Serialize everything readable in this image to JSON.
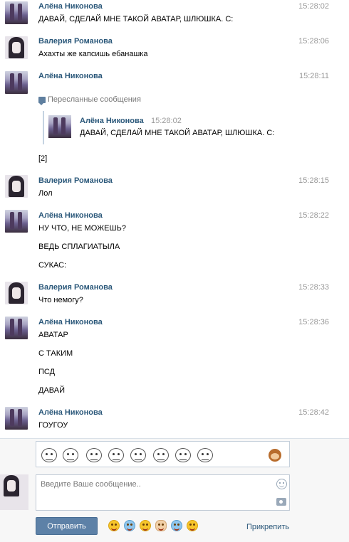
{
  "messages": [
    {
      "author": "Алёна Никонова",
      "time": "15:28:02",
      "lines": [
        "ДАВАЙ, СДЕЛАЙ МНЕ ТАКОЙ АВАТАР, ШЛЮШКА. С:"
      ]
    },
    {
      "author": "Валерия Романова",
      "time": "15:28:06",
      "lines": [
        "Ахахты же капсишь ебанашка"
      ]
    },
    {
      "author": "Алёна Никонова",
      "time": "15:28:11",
      "lines": [
        "[2]"
      ]
    },
    {
      "author": "Валерия Романова",
      "time": "15:28:15",
      "lines": [
        "Лол"
      ]
    },
    {
      "author": "Алёна Никонова",
      "time": "15:28:22",
      "lines": [
        "НУ ЧТО, НЕ МОЖЕШЬ?",
        "ВЕДЬ СПЛАГИАТЫЛА",
        "СУКАС:"
      ]
    },
    {
      "author": "Валерия Романова",
      "time": "15:28:33",
      "lines": [
        "Что немогу?"
      ]
    },
    {
      "author": "Алёна Никонова",
      "time": "15:28:36",
      "lines": [
        "АВАТАР",
        "С ТАКИМ",
        "ПСД",
        "ДАВАЙ"
      ]
    },
    {
      "author": "Алёна Никонова",
      "time": "15:28:42",
      "lines": [
        "ГОУГОУ"
      ]
    }
  ],
  "forwarded": {
    "label": "Пересланные сообщения",
    "author": "Алёна Никонова",
    "time": "15:28:02",
    "text": "ДАВАЙ, СДЕЛАЙ МНЕ ТАКОЙ АВАТАР, ШЛЮШКА. С:"
  },
  "composer": {
    "placeholder": "Введите Ваше сообщение..",
    "send_label": "Отправить",
    "attach_label": "Прикрепить"
  },
  "icons": {
    "stickers": [
      "meme-face-icon",
      "meme-face-icon",
      "meme-face-icon",
      "meme-face-icon",
      "meme-face-icon",
      "meme-face-icon",
      "meme-face-icon",
      "meme-face-icon"
    ],
    "emoji": [
      "smile-emoji-icon",
      "crying-emoji-icon",
      "laughing-emoji-icon",
      "ok-hand-emoji-icon",
      "tears-of-joy-emoji-icon",
      "grin-emoji-icon"
    ]
  },
  "colors": {
    "author": "#2b587a",
    "time": "#999999",
    "send_button": "#5d81a7",
    "link": "#2b587a"
  }
}
